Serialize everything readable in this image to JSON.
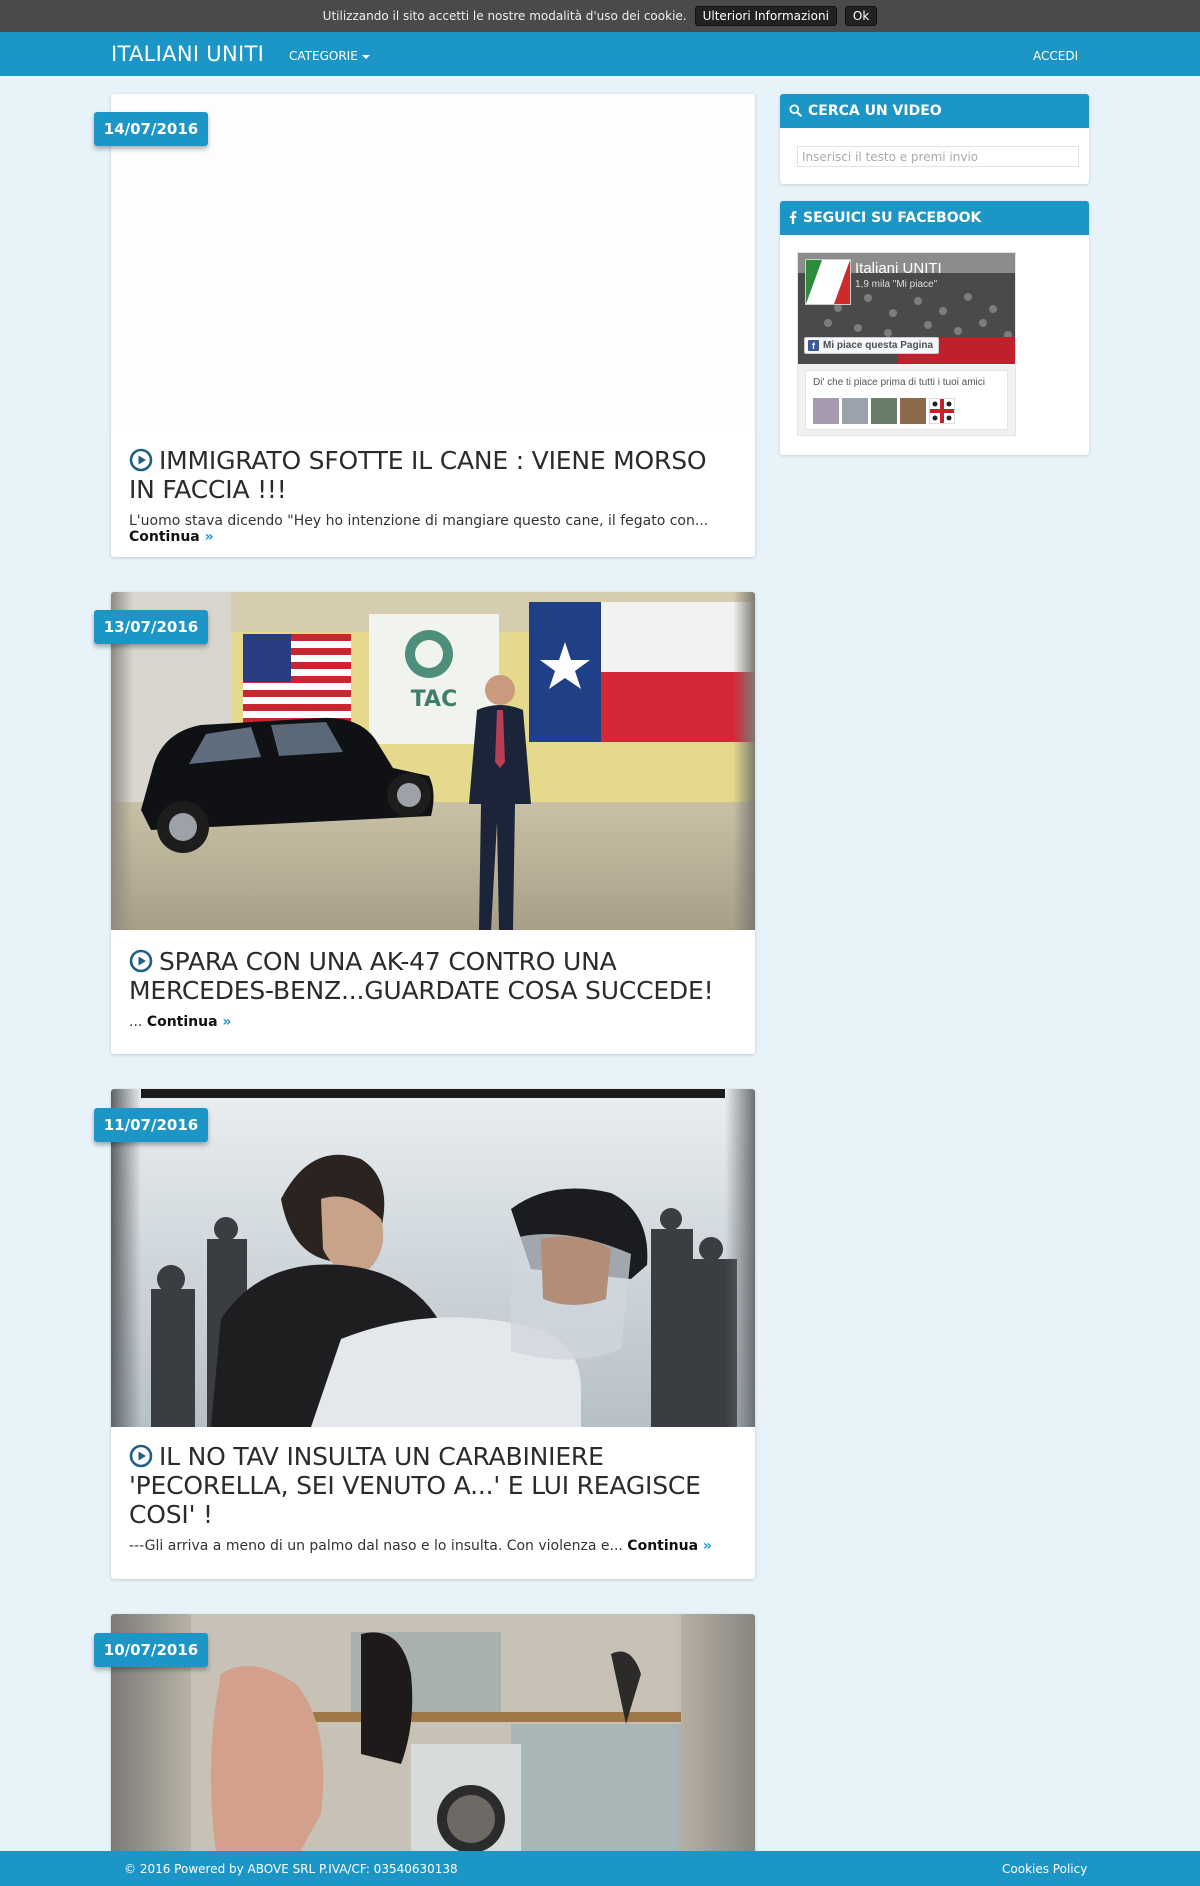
{
  "cookie_bar": {
    "message": "Utilizzando il sito accetti le nostre modalità d'uso dei cookie.",
    "more_info_label": "Ulteriori Informazioni",
    "ok_label": "Ok"
  },
  "navbar": {
    "brand": "ITALIANI UNITI",
    "categories_label": "CATEGORIE",
    "login_label": "ACCEDI"
  },
  "posts": [
    {
      "date": "14/07/2016",
      "title": "IMMIGRATO SFOTTE IL CANE : VIENE MORSO IN FACCIA !!!",
      "excerpt": "L'uomo stava dicendo \"Hey ho intenzione di mangiare questo cane, il fegato con...",
      "more_label": "Continua"
    },
    {
      "date": "13/07/2016",
      "title": "SPARA CON UNA AK-47 CONTRO UNA MERCEDES-BENZ...GUARDATE COSA SUCCEDE!",
      "excerpt": "...",
      "more_label": "Continua",
      "thumb_sign": "TAC"
    },
    {
      "date": "11/07/2016",
      "title": "IL NO TAV INSULTA UN CARABINIERE 'PECORELLA, SEI VENUTO A...' E LUI REAGISCE COSI' !",
      "excerpt": "---Gli arriva a meno di un palmo dal naso e lo insulta. Con violenza e...",
      "more_label": "Continua"
    },
    {
      "date": "10/07/2016"
    }
  ],
  "sidebar": {
    "search": {
      "title": "CERCA UN VIDEO",
      "placeholder": "Inserisci il testo e premi invio"
    },
    "facebook": {
      "title": "SEGUICI SU FACEBOOK",
      "page_name": "Italiani UNITI",
      "likes": "1,9 mila \"Mi piace\"",
      "like_button": "Mi piace questa Pagina",
      "friends_text": "Di' che ti piace prima di tutti i tuoi amici"
    }
  },
  "footer": {
    "copyright": "© 2016 Powered by ABOVE SRL P.IVA/CF: 03540630138",
    "cookies_policy": "Cookies Policy"
  },
  "colors": {
    "brand_blue": "#1b96c6",
    "page_bg": "#e8f3f9",
    "cookie_bar_bg": "#4a4a4a"
  },
  "icons": {
    "play": "play-circle-icon",
    "search": "search-icon",
    "facebook": "facebook-icon",
    "more": "double-chevron-right-icon",
    "caret": "caret-down-icon"
  }
}
